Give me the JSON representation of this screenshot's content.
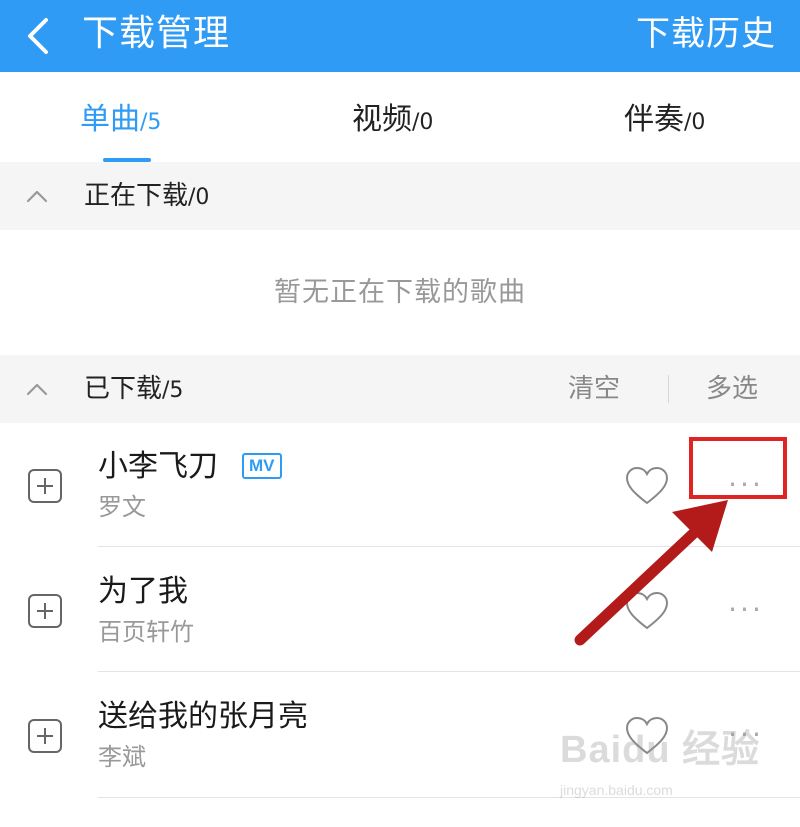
{
  "header": {
    "title": "下载管理",
    "history_label": "下载历史",
    "back_icon": "chevron-left-icon",
    "background_color": "#2f9bf5"
  },
  "tabs": [
    {
      "label": "单曲",
      "count": "/5",
      "active": true
    },
    {
      "label": "视频",
      "count": "/0",
      "active": false
    },
    {
      "label": "伴奏",
      "count": "/0",
      "active": false
    }
  ],
  "downloading": {
    "label": "正在下载",
    "count": "/0",
    "empty_message": "暂无正在下载的歌曲",
    "collapse_icon": "chevron-up-icon"
  },
  "downloaded": {
    "label": "已下载",
    "count": "/5",
    "clear_label": "清空",
    "multi_select_label": "多选",
    "collapse_icon": "chevron-up-icon"
  },
  "songs": [
    {
      "title": "小李飞刀",
      "artist": "罗文",
      "badge": "MV"
    },
    {
      "title": "为了我",
      "artist": "百页轩竹"
    },
    {
      "title": "送给我的张月亮",
      "artist": "李斌"
    }
  ],
  "row_actions": {
    "add_icon": "plus-square-icon",
    "favorite_icon": "heart-outline-icon",
    "more_label": "···"
  },
  "annotation": {
    "highlight_color": "#e02424",
    "arrow_color": "#c81e1e"
  },
  "watermark": {
    "brand": "Baidu 经验",
    "url": "jingyan.baidu.com"
  }
}
